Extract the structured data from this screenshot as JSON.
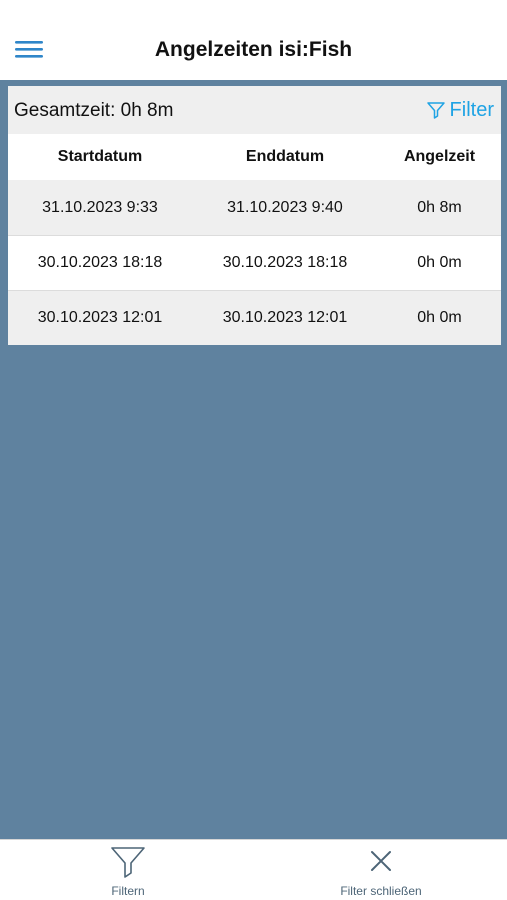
{
  "header": {
    "title": "Angelzeiten isi:Fish",
    "menu_icon": "hamburger-menu-icon"
  },
  "summary": {
    "total_label": "Gesamtzeit: 0h 8m",
    "filter_label": "Filter",
    "filter_icon": "funnel-icon"
  },
  "table": {
    "columns": [
      "Startdatum",
      "Enddatum",
      "Angelzeit"
    ],
    "rows": [
      [
        "31.10.2023 9:33",
        "31.10.2023 9:40",
        "0h 8m"
      ],
      [
        "30.10.2023 18:18",
        "30.10.2023 18:18",
        "0h 0m"
      ],
      [
        "30.10.2023 12:01",
        "30.10.2023 12:01",
        "0h 0m"
      ]
    ]
  },
  "toolbar": {
    "filter_label": "Filtern",
    "filter_icon": "funnel-icon",
    "close_label": "Filter schließen",
    "close_icon": "close-icon"
  },
  "colors": {
    "background": "#5f829f",
    "accent": "#1fa3e4",
    "header_text": "#111111",
    "toolbar_icon": "#4d6577"
  }
}
